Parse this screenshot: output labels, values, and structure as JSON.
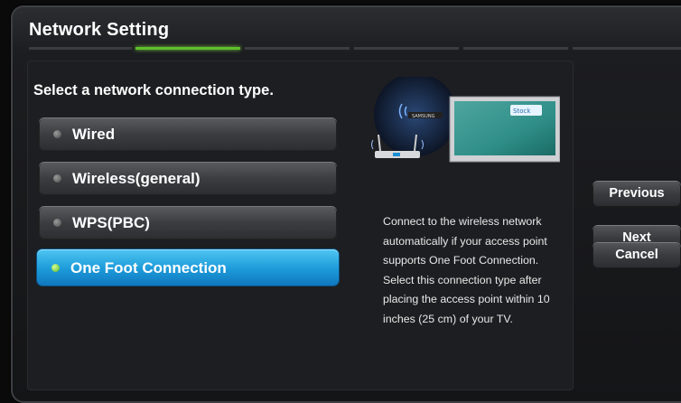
{
  "window": {
    "title": "Network Setting"
  },
  "progress": {
    "total_steps": 6,
    "active_step": 2
  },
  "main": {
    "prompt": "Select a network connection type.",
    "options": [
      {
        "label": "Wired",
        "selected": false
      },
      {
        "label": "Wireless(general)",
        "selected": false
      },
      {
        "label": "WPS(PBC)",
        "selected": false
      },
      {
        "label": "One Foot Connection",
        "selected": true
      }
    ],
    "description": "Connect to the wireless network automatically if your access point supports One Foot Connection. Select this connection type after placing the access point within 10 inches (25 cm) of your TV.",
    "illustration": {
      "tv_brand": "SAMSUNG",
      "screen_logo": "Stock"
    }
  },
  "buttons": {
    "previous": "Previous",
    "next": "Next",
    "cancel": "Cancel"
  },
  "colors": {
    "selected": "#1c9ad9",
    "step_active": "#5fbf2c",
    "background": "#141517"
  }
}
